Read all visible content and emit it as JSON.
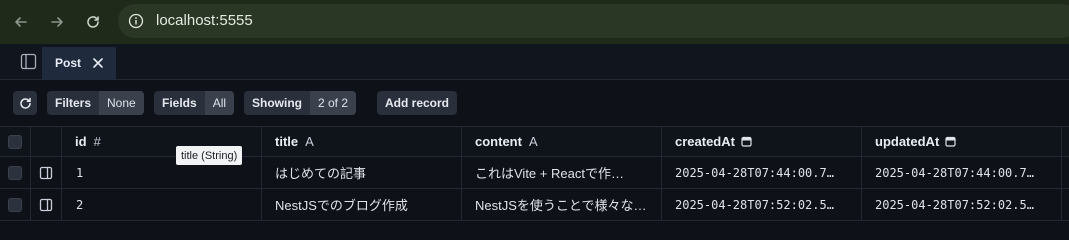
{
  "browser": {
    "url": "localhost:5555",
    "back_icon": "arrow-left-icon",
    "forward_icon": "arrow-right-icon",
    "reload_icon": "reload-icon",
    "info_icon": "info-icon"
  },
  "tabs": [
    {
      "label": "Post",
      "active": true
    }
  ],
  "toolbar": {
    "filters_label": "Filters",
    "filters_value": "None",
    "fields_label": "Fields",
    "fields_value": "All",
    "showing_label": "Showing",
    "showing_value": "2 of 2",
    "add_record_label": "Add record"
  },
  "table": {
    "columns": [
      {
        "name": "id",
        "type_glyph": "#"
      },
      {
        "name": "title",
        "type_glyph": "A"
      },
      {
        "name": "content",
        "type_glyph": "A"
      },
      {
        "name": "createdAt",
        "type_icon": "calendar-icon"
      },
      {
        "name": "updatedAt",
        "type_icon": "calendar-icon"
      }
    ],
    "rows": [
      {
        "id": "1",
        "title": "はじめての記事",
        "content": "これはVite + Reactで作…",
        "createdAt": "2025-04-28T07:44:00.7…",
        "updatedAt": "2025-04-28T07:44:00.7…"
      },
      {
        "id": "2",
        "title": "NestJSでのブログ作成",
        "content": "NestJSを使うことで様々な…",
        "createdAt": "2025-04-28T07:52:02.5…",
        "updatedAt": "2025-04-28T07:52:02.5…"
      }
    ]
  },
  "tooltip": "title (String)",
  "colors": {
    "background": "#0e1117",
    "browser_bar": "#1f2a1a",
    "tab_active": "#1f2a3d",
    "button": "#2a303b"
  }
}
